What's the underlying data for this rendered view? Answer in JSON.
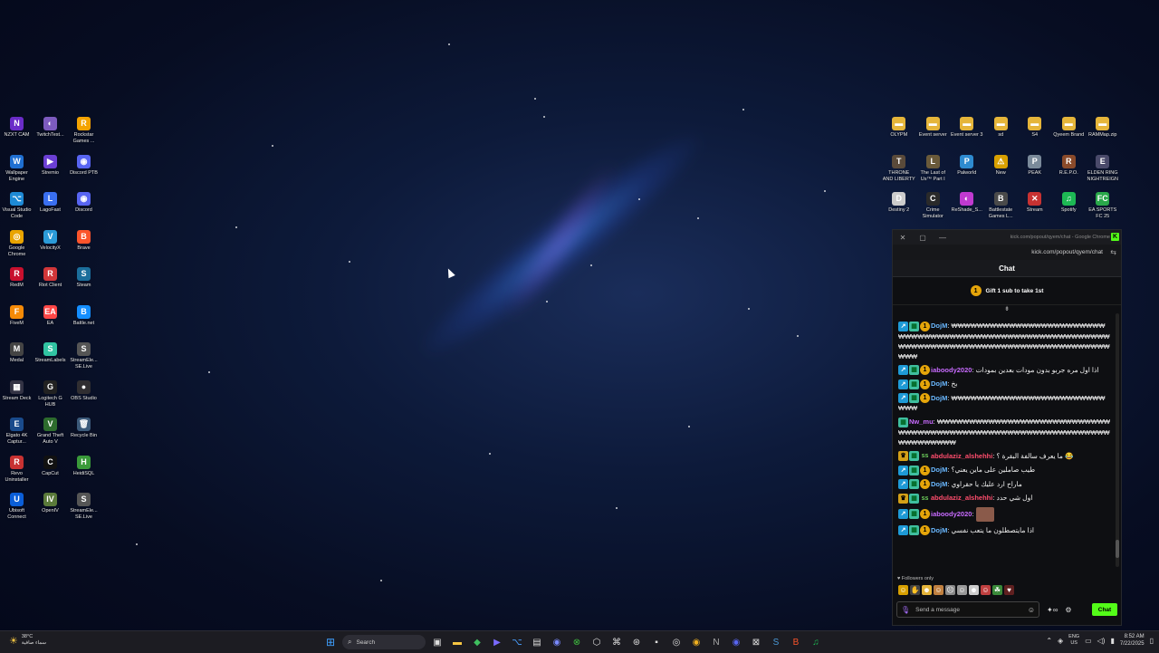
{
  "desktop": {
    "left_icons": [
      {
        "label": "NZXT CAM",
        "glyph": "N",
        "color": "#6a2cc8"
      },
      {
        "label": "TwitchTest...",
        "glyph": "◐",
        "color": "#7d5bbe"
      },
      {
        "label": "Rockstar Games ...",
        "glyph": "R",
        "color": "#f4a300"
      },
      {
        "label": "Wallpaper Engine",
        "glyph": "W",
        "color": "#1f6fd1"
      },
      {
        "label": "Stremio",
        "glyph": "▶",
        "color": "#6b3fd4"
      },
      {
        "label": "Discord PTB",
        "glyph": "◉",
        "color": "#5865f2"
      },
      {
        "label": "Visual Studio Code",
        "glyph": "⌥",
        "color": "#1e8ad6"
      },
      {
        "label": "LagoFast",
        "glyph": "L",
        "color": "#3a6ff0"
      },
      {
        "label": "Discord",
        "glyph": "◉",
        "color": "#5865f2"
      },
      {
        "label": "Google Chrome",
        "glyph": "◎",
        "color": "#e9a400"
      },
      {
        "label": "VelocityX",
        "glyph": "V",
        "color": "#2b9bd8"
      },
      {
        "label": "Brave",
        "glyph": "B",
        "color": "#fb542b"
      },
      {
        "label": "RedM",
        "glyph": "R",
        "color": "#c8102e"
      },
      {
        "label": "Riot Client",
        "glyph": "R",
        "color": "#d13639"
      },
      {
        "label": "Steam",
        "glyph": "S",
        "color": "#1b6e9b"
      },
      {
        "label": "FiveM",
        "glyph": "F",
        "color": "#f58a07"
      },
      {
        "label": "EA",
        "glyph": "EA",
        "color": "#ff4747"
      },
      {
        "label": "Battle.net",
        "glyph": "B",
        "color": "#148eff"
      },
      {
        "label": "Medal",
        "glyph": "M",
        "color": "#444444"
      },
      {
        "label": "StreamLabels",
        "glyph": "S",
        "color": "#31c3a2"
      },
      {
        "label": "StreamEle... SE.Live",
        "glyph": "S",
        "color": "#555555"
      },
      {
        "label": "Stream Deck",
        "glyph": "▦",
        "color": "#333344"
      },
      {
        "label": "Logitech G HUB",
        "glyph": "G",
        "color": "#222222"
      },
      {
        "label": "OBS Studio",
        "glyph": "●",
        "color": "#302e31"
      },
      {
        "label": "Elgato 4K Captur...",
        "glyph": "E",
        "color": "#1a4b8c"
      },
      {
        "label": "Grand Theft Auto V",
        "glyph": "V",
        "color": "#2d6b2d"
      },
      {
        "label": "Recycle Bin",
        "glyph": "🗑",
        "color": "#3c5a7a"
      },
      {
        "label": "Revo Uninstaller",
        "glyph": "R",
        "color": "#c83232"
      },
      {
        "label": "CapCut",
        "glyph": "C",
        "color": "#111111"
      },
      {
        "label": "HeidiSQL",
        "glyph": "H",
        "color": "#3a9a3a"
      },
      {
        "label": "Ubisoft Connect",
        "glyph": "U",
        "color": "#0b5ed7"
      },
      {
        "label": "OpenIV",
        "glyph": "IV",
        "color": "#5a7a3a"
      },
      {
        "label": "StreamEle... SE.Live",
        "glyph": "S",
        "color": "#555555"
      }
    ],
    "right_icons": [
      {
        "label": "OLYPM",
        "glyph": "▬",
        "color": "#e5b53a"
      },
      {
        "label": "Event server",
        "glyph": "▬",
        "color": "#e5b53a"
      },
      {
        "label": "Event server 3",
        "glyph": "▬",
        "color": "#e5b53a"
      },
      {
        "label": "sd",
        "glyph": "▬",
        "color": "#e5b53a"
      },
      {
        "label": "S4",
        "glyph": "▬",
        "color": "#e5b53a"
      },
      {
        "label": "Qyeem Brand",
        "glyph": "▬",
        "color": "#e5b53a"
      },
      {
        "label": "RAMMap.zip",
        "glyph": "▬",
        "color": "#e5b53a"
      },
      {
        "label": "THRONE AND LIBERTY",
        "glyph": "T",
        "color": "#5a4a3a"
      },
      {
        "label": "The Last of Us™ Part I",
        "glyph": "L",
        "color": "#6a5a3a"
      },
      {
        "label": "Palworld",
        "glyph": "P",
        "color": "#2e8bd0"
      },
      {
        "label": "New",
        "glyph": "⚠",
        "color": "#d8a000"
      },
      {
        "label": "PEAK",
        "glyph": "P",
        "color": "#7a8a9a"
      },
      {
        "label": "R.E.P.O.",
        "glyph": "R",
        "color": "#8a4a2a"
      },
      {
        "label": "ELDEN RING NIGHTREIGN",
        "glyph": "E",
        "color": "#4a4a6a"
      },
      {
        "label": "Destiny 2",
        "glyph": "D",
        "color": "#cccccc"
      },
      {
        "label": "Crime Simulator",
        "glyph": "C",
        "color": "#2a2a2a"
      },
      {
        "label": "ReShade_S...",
        "glyph": "◐",
        "color": "#c03ad0"
      },
      {
        "label": "Battlestate Games L...",
        "glyph": "B",
        "color": "#4a4a4a"
      },
      {
        "label": "Stream",
        "glyph": "✕",
        "color": "#c83232"
      },
      {
        "label": "Spotify",
        "glyph": "♫",
        "color": "#1db954"
      },
      {
        "label": "EA SPORTS FC 25",
        "glyph": "FC",
        "color": "#2aa84a"
      }
    ]
  },
  "chat_window": {
    "title": "kick.com/popout/qyem/chat - Google Chrome",
    "url": "kick.com/popout/qyem/chat",
    "header": "Chat",
    "gift_text": "Gift 1 sub to take 1st",
    "followers_only": "Followers only",
    "input_placeholder": "Send a message",
    "send_label": "Chat",
    "colors": {
      "accent": "#53fc18"
    },
    "messages": [
      {
        "badges": [
          "arrow",
          "sub",
          "coin"
        ],
        "user": "DojM",
        "color": "#6ab8ff",
        "text": "₩₩₩₩₩₩₩₩₩₩₩₩₩₩₩₩₩₩₩₩₩₩₩₩₩₩₩₩₩₩₩₩₩₩₩₩₩₩₩₩₩₩₩₩₩₩₩₩₩₩₩₩₩₩₩₩₩₩₩₩₩₩₩₩₩₩₩₩₩₩₩₩₩₩₩₩₩₩₩₩₩₩₩₩₩₩₩₩₩₩₩₩₩"
      },
      {
        "badges": [
          "arrow",
          "sub",
          "coin"
        ],
        "user": "iaboody2020",
        "color": "#c86bff",
        "text": "اذا اول مره جربو بدون مودات بعدين بمودات"
      },
      {
        "badges": [
          "arrow",
          "sub",
          "coin"
        ],
        "user": "DojM",
        "color": "#6ab8ff",
        "text": "بخ"
      },
      {
        "badges": [
          "arrow",
          "sub",
          "coin"
        ],
        "user": "DojM",
        "color": "#6ab8ff",
        "text": "₩₩₩₩₩₩₩₩₩₩₩₩₩₩₩₩₩₩₩₩₩₩₩₩₩₩₩"
      },
      {
        "badges": [
          "sub"
        ],
        "user": "Nw_mu",
        "color": "#c86bff",
        "text": "₩₩₩₩₩₩₩₩₩₩₩₩₩₩₩₩₩₩₩₩₩₩₩₩₩₩₩₩₩₩₩₩₩₩₩₩₩₩₩₩₩₩₩₩₩₩₩₩₩₩₩₩₩₩₩₩₩₩₩₩₩₩₩₩₩₩₩₩₩"
      },
      {
        "badges": [
          "crown",
          "sub",
          "ss"
        ],
        "user": "abdulaziz_alshehhi",
        "color": "#ff4d6d",
        "text": "ما يعرف سالفة البقرة ؟ 😂"
      },
      {
        "badges": [
          "arrow",
          "sub",
          "coin"
        ],
        "user": "DojM",
        "color": "#6ab8ff",
        "text": "طيب صاملين على ماين يعني؟"
      },
      {
        "badges": [
          "arrow",
          "sub",
          "coin"
        ],
        "user": "DojM",
        "color": "#6ab8ff",
        "text": "ماراح ارد عليك يا حقراوي"
      },
      {
        "badges": [
          "crown",
          "sub",
          "ss"
        ],
        "user": "abdulaziz_alshehhi",
        "color": "#ff4d6d",
        "text": "اول شي حدد"
      },
      {
        "badges": [
          "arrow",
          "sub",
          "coin"
        ],
        "user": "iaboody2020",
        "color": "#c86bff",
        "text": ""
      },
      {
        "badges": [
          "arrow",
          "sub",
          "coin"
        ],
        "user": "DojM",
        "color": "#6ab8ff",
        "text": "اذا مايتصطلون ما يتعب نفسي"
      }
    ]
  },
  "taskbar": {
    "weather_temp": "38°C",
    "weather_desc": "سماء صافية",
    "search_placeholder": "Search",
    "lang_top": "ENG",
    "lang_bottom": "US",
    "time": "8:52 AM",
    "date": "7/22/2025",
    "icons": [
      "file-explorer-icon",
      "store-icon",
      "xbox-icon",
      "chrome-icon",
      "discord-icon",
      "steam-icon",
      "brave-icon",
      "spotify-icon"
    ]
  }
}
